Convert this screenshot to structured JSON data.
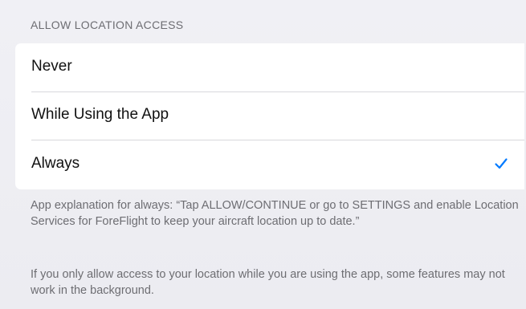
{
  "section": {
    "title": "ALLOW LOCATION ACCESS"
  },
  "options": [
    {
      "label": "Never",
      "selected": false
    },
    {
      "label": "While Using the App",
      "selected": false
    },
    {
      "label": "Always",
      "selected": true
    }
  ],
  "footer": {
    "explanation": "App explanation for always: “Tap ALLOW/CONTINUE or go to SETTINGS and enable Location Services for ForeFlight to keep your aircraft location up to date.”",
    "note": "If you only allow access to your location while you are using the app, some features may not work in the background."
  },
  "colors": {
    "accent": "#007aff",
    "background": "#efeff4",
    "secondary_text": "#6d6d72"
  },
  "icons": {
    "selected_indicator": "checkmark-icon"
  }
}
